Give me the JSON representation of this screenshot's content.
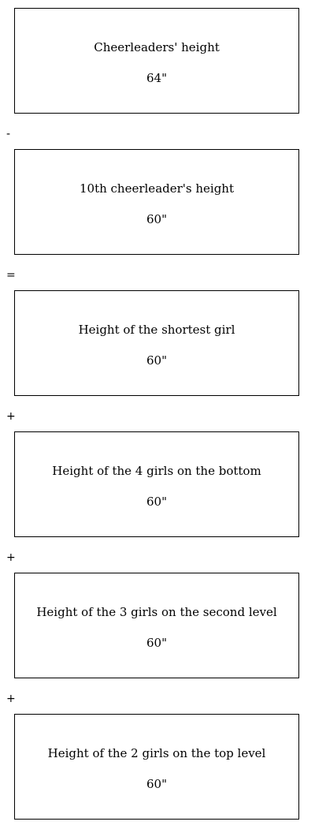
{
  "boxes": [
    {
      "title": "Cheerleaders' height",
      "value": "64\""
    },
    {
      "title": "10th cheerleader's height",
      "value": "60\""
    },
    {
      "title": "Height of the shortest girl",
      "value": "60\""
    },
    {
      "title": "Height of the 4 girls on the bottom",
      "value": "60\""
    },
    {
      "title": "Height of the 3 girls on the second level",
      "value": "60\""
    },
    {
      "title": "Height of the 2 girls on the top level",
      "value": "60\""
    }
  ],
  "operators": [
    "-",
    "=",
    "+",
    "+",
    "+"
  ]
}
